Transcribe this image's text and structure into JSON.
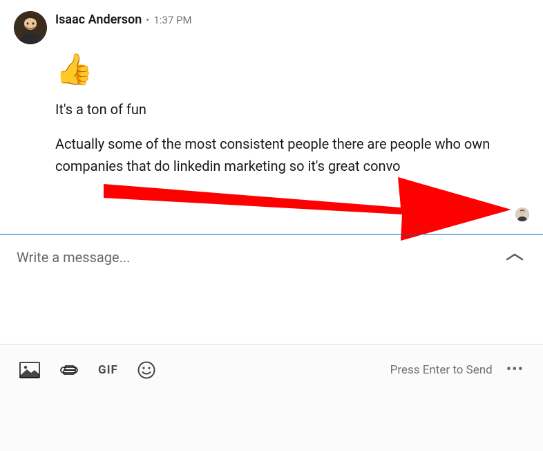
{
  "message": {
    "sender_name": "Isaac Anderson",
    "timestamp": "1:37 PM",
    "separator": "•",
    "emoji": "👍",
    "line1": "It's a ton of fun",
    "line2": "Actually some of the most consistent people there are people who own companies that do linkedin marketing so it's great convo"
  },
  "compose": {
    "placeholder": "Write a message..."
  },
  "toolbar": {
    "gif_label": "GIF",
    "send_hint": "Press Enter to Send",
    "more": "•••"
  },
  "annotation": {
    "arrow_color": "#ff0000"
  }
}
